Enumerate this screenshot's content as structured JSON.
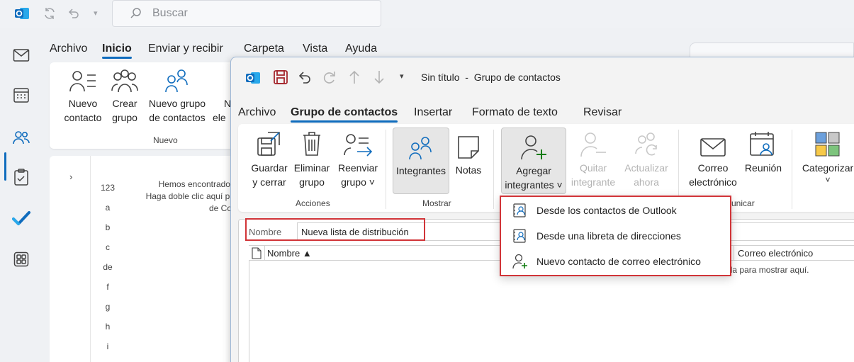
{
  "app": {
    "search_placeholder": "Buscar"
  },
  "main_menu": {
    "tabs": [
      "Archivo",
      "Inicio",
      "Enviar y recibir",
      "Carpeta",
      "Vista",
      "Ayuda"
    ]
  },
  "main_ribbon": {
    "buttons": [
      {
        "line1": "Nuevo",
        "line2": "contacto"
      },
      {
        "line1": "Crear",
        "line2": "grupo"
      },
      {
        "line1": "Nuevo grupo",
        "line2": "de contactos"
      },
      {
        "line1": "N",
        "line2": "ele"
      }
    ],
    "group_label": "Nuevo"
  },
  "contacts_pane": {
    "alphabet": [
      "123",
      "a",
      "b",
      "c",
      "de",
      "f",
      "g",
      "h",
      "i"
    ],
    "empty_line1": "Hemos encontrado n",
    "empty_line2": "Haga doble clic aquí par",
    "empty_line3": "de Co"
  },
  "group_window": {
    "title": "Sin título  -  Grupo de contactos",
    "tabs": [
      "Archivo",
      "Grupo de contactos",
      "Insertar",
      "Formato de texto",
      "Revisar"
    ],
    "ribbon": {
      "acciones": {
        "label": "Acciones",
        "guardar": {
          "line1": "Guardar",
          "line2": "y cerrar"
        },
        "eliminar": {
          "line1": "Eliminar",
          "line2": "grupo"
        },
        "reenviar": {
          "line1": "Reenviar",
          "line2": "grupo ˅"
        }
      },
      "mostrar": {
        "label": "Mostrar",
        "integrantes": "Integrantes",
        "notas": "Notas"
      },
      "integrantes_group": {
        "agregar": {
          "line1": "Agregar",
          "line2": "integrantes ˅"
        },
        "quitar": {
          "line1": "Quitar",
          "line2": "integrante"
        },
        "actualizar": {
          "line1": "Actualizar",
          "line2": "ahora"
        }
      },
      "comunicar": {
        "label": "unicar",
        "correo": {
          "line1": "Correo",
          "line2": "electrónico"
        },
        "reunion": "Reunión"
      },
      "categorizar": {
        "label": "Categorizar",
        "arrow": "˅"
      }
    },
    "name_label": "Nombre",
    "name_value": "Nueva lista de distribución",
    "list": {
      "col_name": "Nombre ▲",
      "col_email": "Correo electrónico",
      "empty_text": "No hemos encontrado nada para mostrar aquí."
    }
  },
  "dropdown": {
    "items": [
      {
        "label": "Desde los contactos de Outlook",
        "icon": "address-book-icon"
      },
      {
        "label": "Desde una libreta de direcciones",
        "icon": "address-book-icon"
      },
      {
        "label": "Nuevo contacto de correo electrónico",
        "icon": "add-person-icon"
      }
    ]
  },
  "colors": {
    "accent": "#0f6cbd",
    "highlight_red": "#d13438",
    "green_plus": "#107c10"
  }
}
